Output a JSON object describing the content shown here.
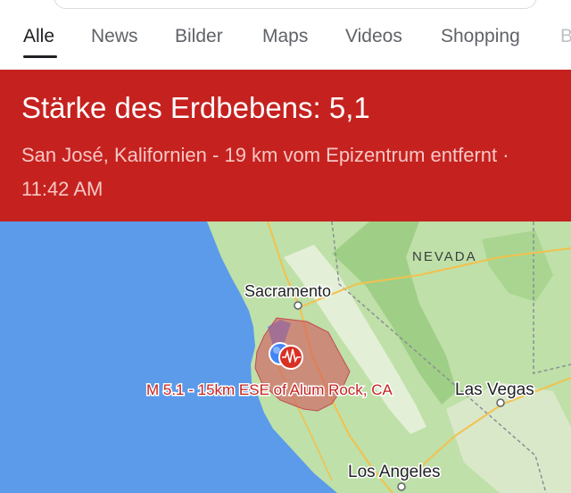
{
  "tabs": [
    {
      "label": "Alle",
      "active": true
    },
    {
      "label": "News"
    },
    {
      "label": "Bilder"
    },
    {
      "label": "Maps"
    },
    {
      "label": "Videos"
    },
    {
      "label": "Shopping"
    },
    {
      "label": "B"
    }
  ],
  "quake": {
    "title": "Stärke des Erdbebens: 5,1",
    "subtitle": "San José, Kalifornien - 19 km vom Epizentrum entfernt · 11:42 AM",
    "map_label": "M 5.1 - 15km ESE of Alum Rock, CA"
  },
  "map": {
    "state_label": "NEVADA",
    "cities": [
      "Sacramento",
      "Las Vegas",
      "Los Angeles"
    ]
  },
  "colors": {
    "banner_bg": "#c5221f",
    "water": "#5b9bea",
    "land": "#bfe0a8",
    "quake_zone": "#d3545b",
    "quake_marker": "#d93025",
    "location_dot": "#4285f4"
  }
}
